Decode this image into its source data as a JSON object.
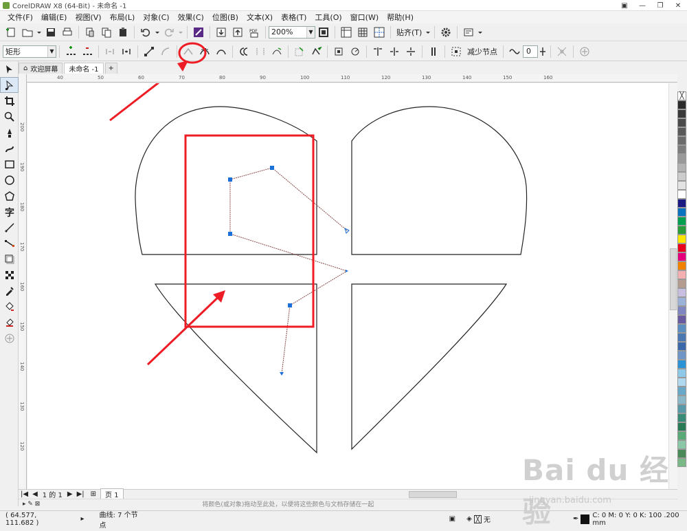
{
  "window": {
    "title": "CorelDRAW X8 (64-Bit) - 未命名 -1"
  },
  "menu": [
    "文件(F)",
    "编辑(E)",
    "视图(V)",
    "布局(L)",
    "对象(C)",
    "效果(C)",
    "位图(B)",
    "文本(X)",
    "表格(T)",
    "工具(O)",
    "窗口(W)",
    "帮助(H)"
  ],
  "toolbar": {
    "zoom_value": "200%",
    "snap_label": "贴齐(T)"
  },
  "property_bar": {
    "shape_selector": "矩形",
    "reduce_nodes_label": "减少节点",
    "smoothness_value": "0"
  },
  "tabs": {
    "welcome": "欢迎屏幕",
    "document": "未命名 -1"
  },
  "ruler": {
    "h_ticks": [
      "40",
      "50",
      "60",
      "70",
      "80",
      "90",
      "100",
      "110",
      "120",
      "130",
      "140",
      "150",
      "160"
    ],
    "v_ticks": [
      "200",
      "190",
      "180",
      "170",
      "160",
      "150",
      "140",
      "130",
      "120"
    ]
  },
  "page_nav": {
    "page_counter": "1 的 1",
    "page_tab": "页 1"
  },
  "colorbar_hint": "将颜色(或对象)拖动至此处，以便将这些颜色与文档存储在一起",
  "status": {
    "coords": "( 64.577, 111.682 )",
    "info": "曲线: 7 个节点",
    "fill_none": "无",
    "outline": "C: 0 M: 0 Y: 0 K: 100  .200 mm"
  },
  "palette": [
    "#2b2b2b",
    "#3a3a3a",
    "#4a4a4a",
    "#5a5a5a",
    "#6c6c6c",
    "#7e7e7e",
    "#999999",
    "#b3b3b3",
    "#cccccc",
    "#e3e3e3",
    "#ffffff",
    "#1b1a82",
    "#0b72c0",
    "#00a050",
    "#2c9c3a",
    "#ffe600",
    "#e8001c",
    "#e4007d",
    "#f08200",
    "#f4b0b0",
    "#b39b8d",
    "#c8bfe0",
    "#9db2d8",
    "#7f86c0",
    "#6a5aa0",
    "#5c8fc0",
    "#4b78b0",
    "#3a68a8",
    "#7096c8",
    "#2b92d6",
    "#8dc8e8",
    "#b0d8ee",
    "#6aa8c8",
    "#8ab8c8",
    "#5a9aa8",
    "#3a8a78",
    "#2a7a58",
    "#5aaa78",
    "#8ac8a8",
    "#4a8a58",
    "#7ab888"
  ],
  "accent": {
    "annotation_red": "#ee1c24",
    "node_blue": "#1a6fd8"
  },
  "watermark": {
    "logo": "Bai du 经验",
    "url": "jingyan.baidu.com"
  }
}
